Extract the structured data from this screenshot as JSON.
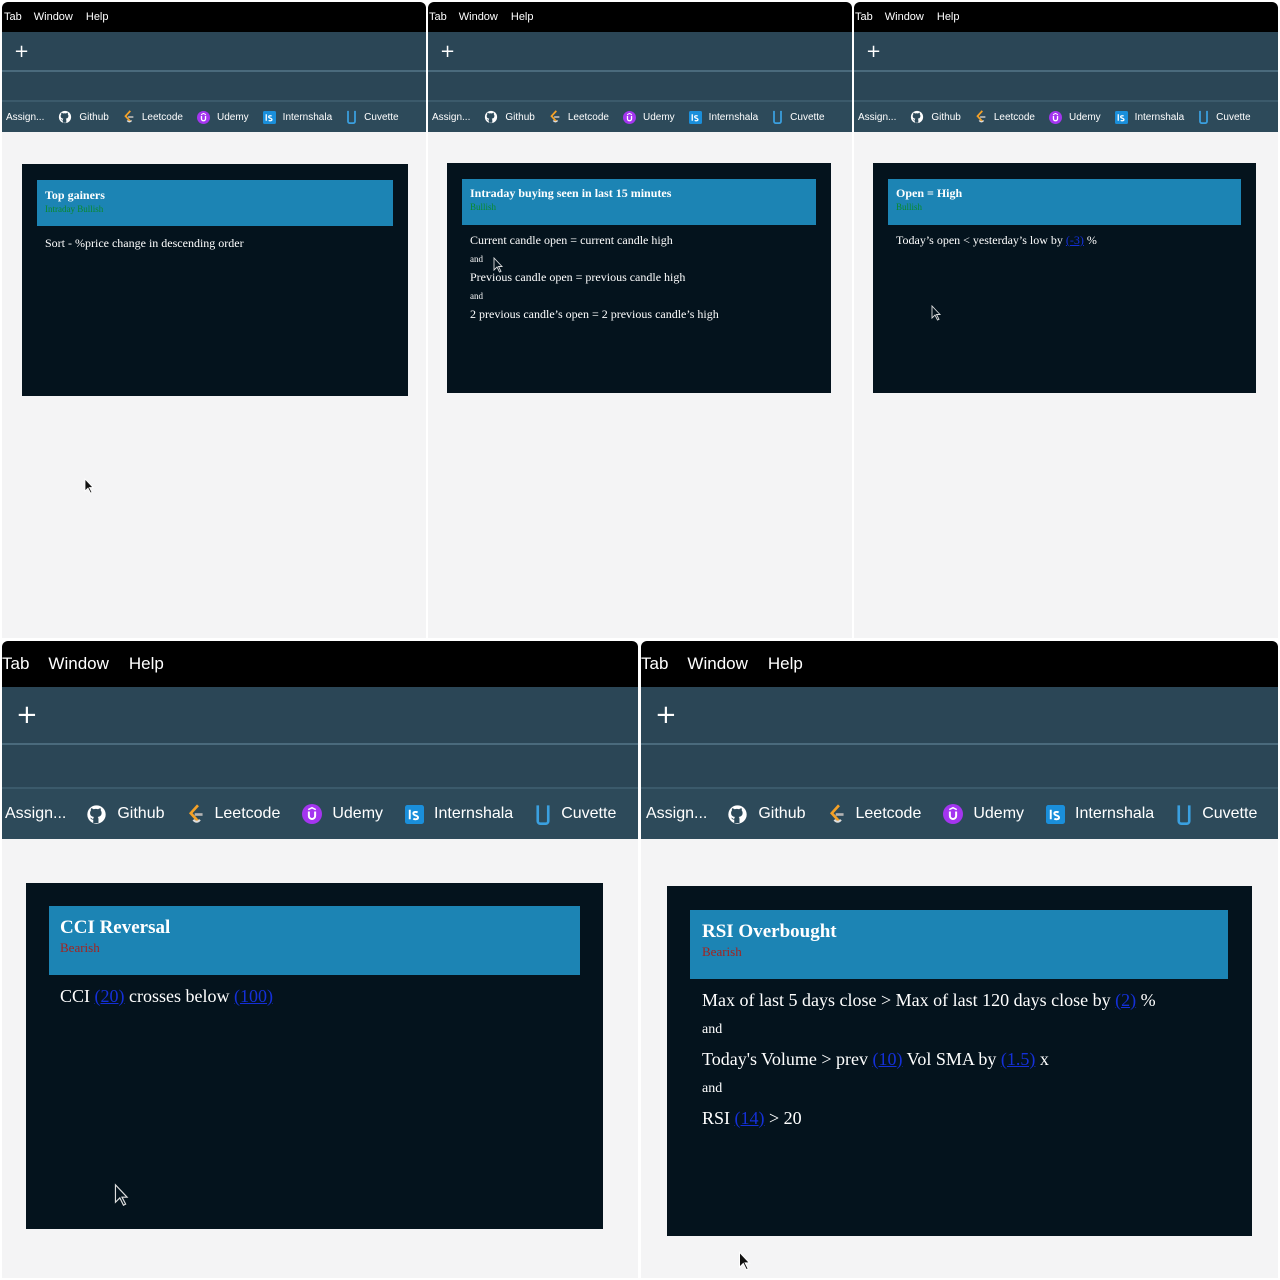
{
  "menu": {
    "tab": "Tab",
    "window": "Window",
    "help": "Help"
  },
  "new_tab_symbol": "+",
  "bookmarks": {
    "assign": "Assign...",
    "github": "Github",
    "leetcode": "Leetcode",
    "udemy": "Udemy",
    "internshala": "Internshala",
    "cuvette": "Cuvette"
  },
  "panels": {
    "top_gainers": {
      "title": "Top gainers",
      "tag": "Intraday Bullish",
      "rule": "Sort - %price change in descending order"
    },
    "intraday_buying": {
      "title": "Intraday buying seen in last 15 minutes",
      "tag": "Bullish",
      "line1": "Current candle open = current candle high",
      "and1": "and",
      "line2": "Previous candle open = previous candle high",
      "and2": "and",
      "line3": "2 previous candle’s open = 2 previous candle’s high"
    },
    "open_high": {
      "title": "Open = High",
      "tag": "Bullish",
      "text_a": "Today’s open < yesterday’s low by",
      "param": "(-3)",
      "text_b": "%"
    },
    "cci_reversal": {
      "title": "CCI Reversal",
      "tag": "Bearish",
      "text_a": "CCI",
      "param1": "(20)",
      "text_b": "crosses below",
      "param2": "(100)"
    },
    "rsi_overbought": {
      "title": "RSI Overbought",
      "tag": "Bearish",
      "l1_a": "Max of last 5 days close > Max of last 120 days close by",
      "l1_param": "(2)",
      "l1_b": "%",
      "and1": "and",
      "l2_a": "Today's Volume > prev",
      "l2_param1": "(10)",
      "l2_b": "Vol SMA by",
      "l2_param2": "(1.5)",
      "l2_c": "x",
      "and2": "and",
      "l3_a": "RSI",
      "l3_param": "(14)",
      "l3_b": "> 20"
    }
  },
  "colors": {
    "card_bg": "#04131d",
    "card_header": "#1c84b4",
    "bullish": "#0a8a2c",
    "bearish": "#a5231f",
    "link": "#1430d8",
    "chrome_bar": "#2b4656",
    "page_bg": "#f4f4f5"
  },
  "icons": [
    "github-icon",
    "leetcode-icon",
    "udemy-icon",
    "internshala-icon",
    "cuvette-icon",
    "plus-icon",
    "mouse-pointer-icon"
  ]
}
